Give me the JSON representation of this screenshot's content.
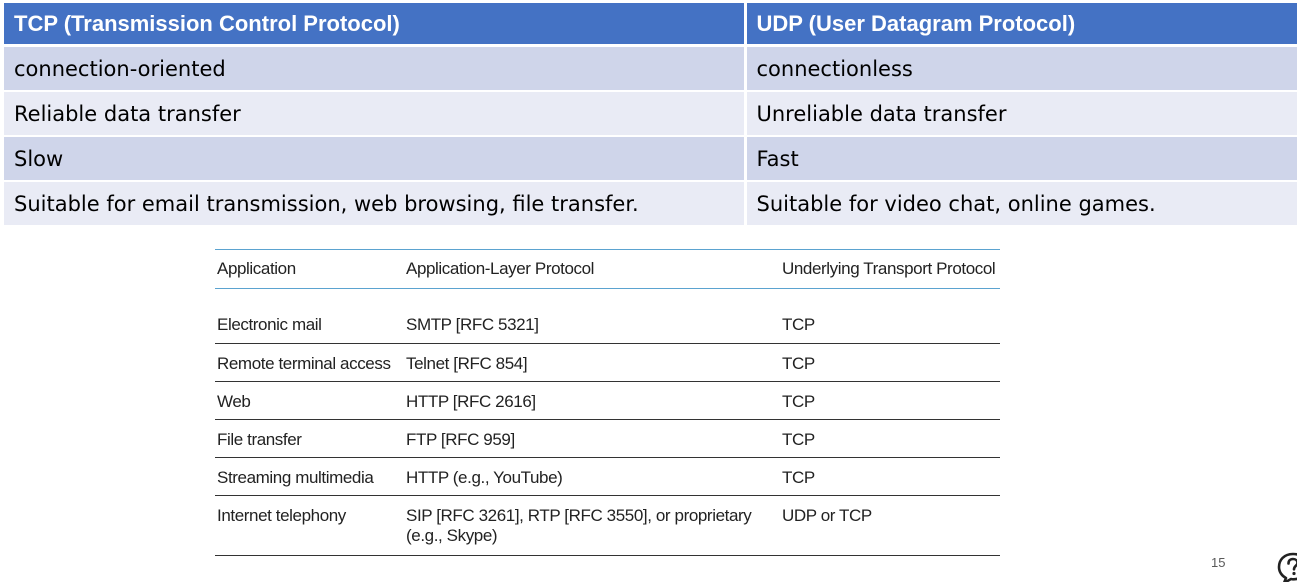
{
  "comparison": {
    "headers": [
      "TCP (Transmission Control Protocol)",
      "UDP (User Datagram Protocol)"
    ],
    "rows": [
      [
        "connection-oriented",
        "connectionless"
      ],
      [
        "Reliable data transfer",
        "Unreliable data transfer"
      ],
      [
        "Slow",
        "Fast"
      ],
      [
        "Suitable for email transmission, web browsing, file transfer.",
        "Suitable for video chat, online games."
      ]
    ]
  },
  "app_table": {
    "headers": [
      "Application",
      "Application-Layer Protocol",
      "Underlying Transport Protocol"
    ],
    "rows": [
      [
        "Electronic mail",
        "SMTP [RFC 5321]",
        "TCP"
      ],
      [
        "Remote terminal access",
        "Telnet [RFC 854]",
        "TCP"
      ],
      [
        "Web",
        "HTTP [RFC 2616]",
        "TCP"
      ],
      [
        "File transfer",
        "FTP [RFC 959]",
        "TCP"
      ],
      [
        "Streaming multimedia",
        "HTTP (e.g., YouTube)",
        "TCP"
      ],
      [
        "Internet telephony",
        "SIP [RFC 3261], RTP [RFC 3550], or proprietary",
        "UDP or TCP"
      ]
    ],
    "last_row_continuation": "(e.g., Skype)"
  },
  "slide_number": "15",
  "icons": {
    "help": "help-bubble-icon"
  },
  "colors": {
    "header_bg": "#4472c4",
    "row_odd": "#cfd5ea",
    "row_even": "#e9ebf5",
    "figure_rule_blue": "#5ba3d0"
  }
}
